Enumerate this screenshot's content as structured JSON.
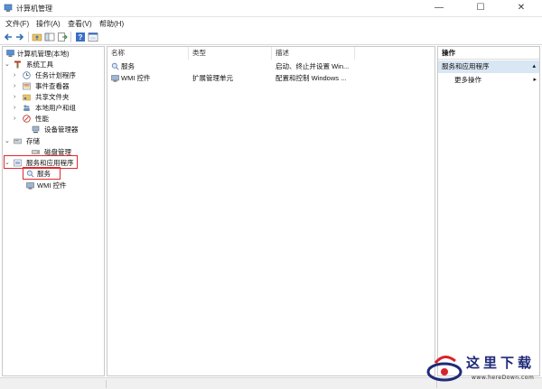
{
  "window": {
    "title": "计算机管理",
    "controls": {
      "minimize": "—",
      "maximize": "☐",
      "close": "✕"
    }
  },
  "menu": [
    "文件(F)",
    "操作(A)",
    "查看(V)",
    "帮助(H)"
  ],
  "toolbar": {
    "icons": [
      "back-arrow-icon",
      "forward-arrow-icon",
      "up-folder-icon",
      "show-hide-tree-icon",
      "export-list-icon",
      "help-icon",
      "properties-icon"
    ]
  },
  "tree": {
    "root": "计算机管理(本地)",
    "system_tools": "系统工具",
    "task_scheduler": "任务计划程序",
    "event_viewer": "事件查看器",
    "shared_folders": "共享文件夹",
    "local_users": "本地用户和组",
    "performance": "性能",
    "device_manager": "设备管理器",
    "storage": "存储",
    "disk_management": "磁盘管理",
    "services_apps": "服务和应用程序",
    "services": "服务",
    "wmi": "WMI 控件"
  },
  "list": {
    "columns": [
      "名称",
      "类型",
      "描述"
    ],
    "rows": [
      {
        "name": "服务",
        "type": "",
        "desc": "启动、终止并设置 Win..."
      },
      {
        "name": "WMI 控件",
        "type": "扩展管理单元",
        "desc": "配置和控制 Windows ..."
      }
    ]
  },
  "actions": {
    "header": "操作",
    "section": "服务和应用程序",
    "more": "更多操作"
  },
  "watermark": {
    "brand": "这里下载",
    "url": "www.hereDown.com"
  },
  "colors": {
    "accent_red": "#e0282e",
    "selection_blue": "#d9e6f3"
  }
}
